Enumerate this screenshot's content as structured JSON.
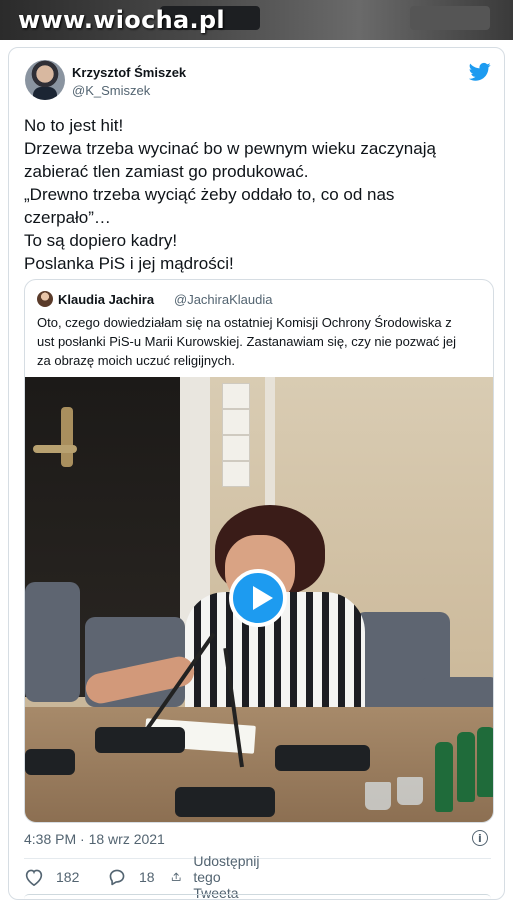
{
  "watermark": "www.wiocha.pl",
  "tweet": {
    "author_name": "Krzysztof Śmiszek",
    "author_handle": "@K_Smiszek",
    "lines": [
      "No to jest hit!",
      "Drzewa trzeba wycinać bo w pewnym wieku zaczynają",
      "zabierać tlen zamiast go produkować.",
      "„Drewno trzeba wyciąć żeby oddało to, co od nas",
      "czerpało”…",
      "To są dopiero kadry!",
      "Poslanka PiS i jej mądrości!"
    ],
    "timestamp": "4:38 PM · 18 wrz 2021",
    "actions": {
      "likes": "182",
      "replies": "18",
      "share_label": "Udostępnij tego Tweeta"
    }
  },
  "quoted_tweet": {
    "author_name": "Klaudia Jachira",
    "author_handle": "@JachiraKlaudia",
    "lines": [
      "Oto, czego dowiedziałam się na ostatniej Komisji Ochrony Środowiska z",
      "ust posłanki PiS-u Marii Kurowskiej. Zastanawiam się, czy nie pozwać jej",
      "za obrazę moich uczuć religijnych."
    ]
  },
  "colors": {
    "accent": "#1d9bf0",
    "text": "#0f1419",
    "secondary": "#536471",
    "border": "#d6dde3"
  },
  "icons": {
    "brand": "twitter-bird-icon",
    "like": "heart-icon",
    "reply": "reply-bubble-icon",
    "share": "share-icon",
    "info": "info-icon",
    "play": "play-icon"
  }
}
